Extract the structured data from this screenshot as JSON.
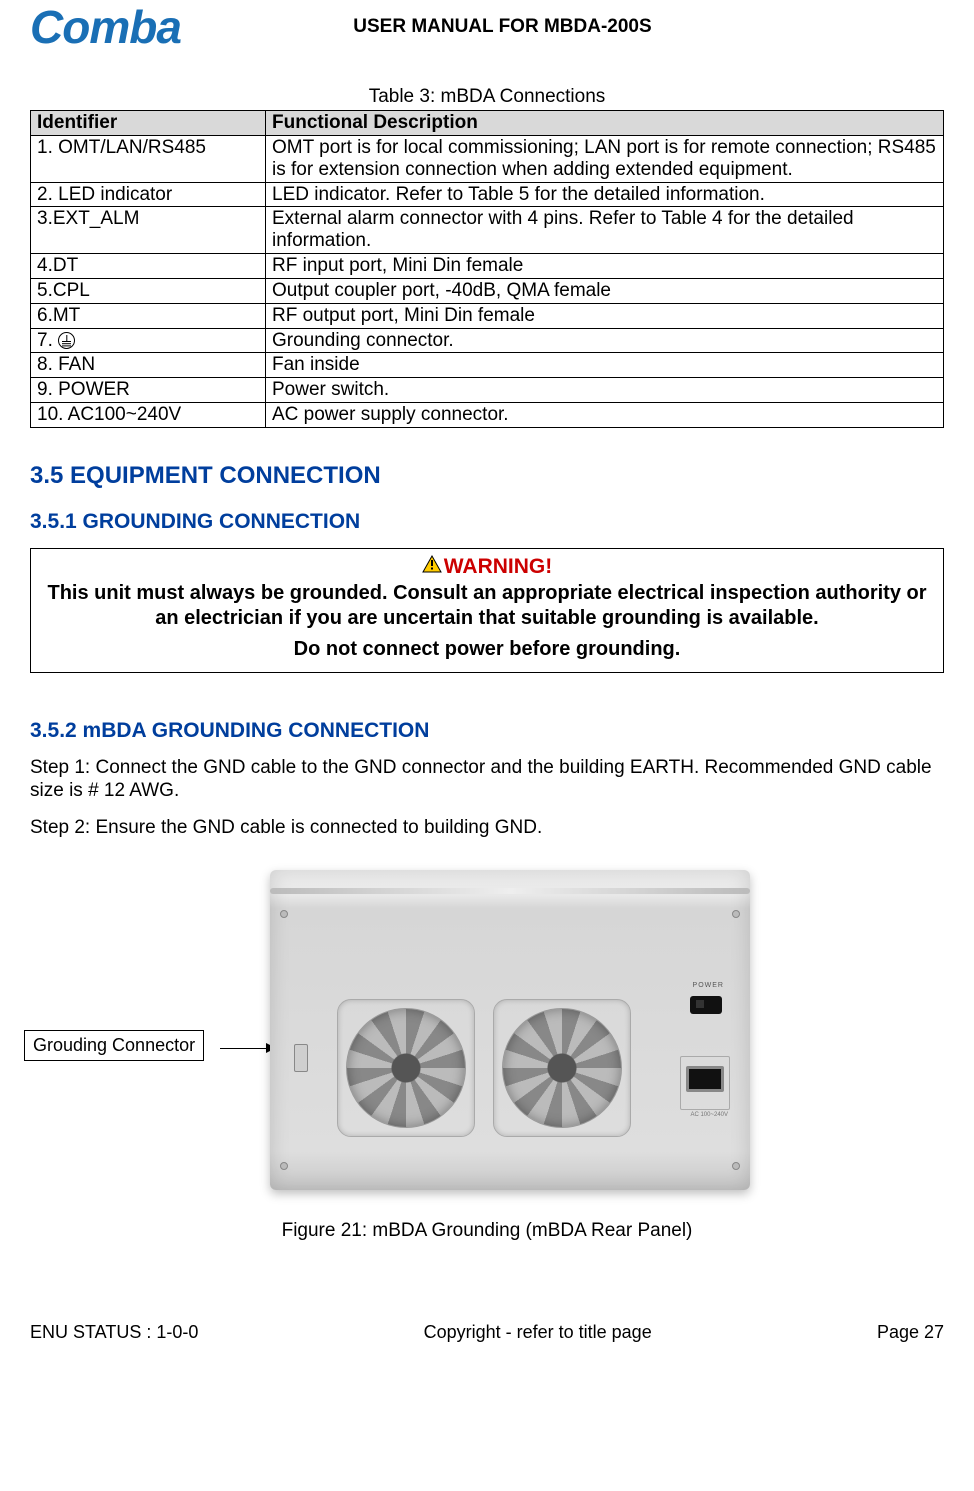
{
  "header": {
    "logo_text": "Comba",
    "title": "USER MANUAL FOR MBDA-200S"
  },
  "table3": {
    "caption": "Table 3: mBDA Connections",
    "headers": [
      "Identifier",
      "Functional Description"
    ],
    "rows": [
      {
        "id": "1. OMT/LAN/RS485",
        "desc": "OMT port is for local commissioning; LAN port is for remote connection; RS485 is for extension connection when adding extended equipment."
      },
      {
        "id": "2. LED indicator",
        "desc": "LED indicator. Refer to Table 5 for the detailed information."
      },
      {
        "id": "3.EXT_ALM",
        "desc": "External alarm connector with 4 pins. Refer to Table 4 for the detailed information."
      },
      {
        "id": "4.DT",
        "desc": "RF input port, Mini Din  female"
      },
      {
        "id": "5.CPL",
        "desc": "Output coupler port, -40dB, QMA female"
      },
      {
        "id": "6.MT",
        "desc": "RF output port, Mini Din  female"
      },
      {
        "id": "7. ",
        "desc": "Grounding connector.",
        "ground_symbol": true
      },
      {
        "id": "8. FAN",
        "desc": "Fan inside"
      },
      {
        "id": "9. POWER",
        "desc": "Power switch."
      },
      {
        "id": "10. AC100~240V",
        "desc": "AC power supply connector."
      }
    ]
  },
  "sections": {
    "s35": "3.5   EQUIPMENT CONNECTION",
    "s351": "3.5.1   GROUNDING CONNECTION",
    "s352": "3.5.2   mBDA GROUNDING CONNECTION"
  },
  "warning": {
    "label": "WARNING!",
    "line1": "This unit must always be grounded. Consult an appropriate electrical inspection authority or an electrician if you are uncertain that suitable grounding is available.",
    "line2": "Do not connect power before grounding."
  },
  "steps": {
    "s1": "Step 1: Connect the GND cable to the GND connector and the building EARTH. Recommended GND cable size is # 12 AWG.",
    "s2": "Step 2: Ensure the GND cable is connected to building GND."
  },
  "figure": {
    "callout": "Grouding Connector",
    "power_label": "POWER",
    "ac_label": "AC 100~240V",
    "caption": "Figure 21: mBDA Grounding (mBDA Rear Panel)"
  },
  "footer": {
    "left": "ENU STATUS : 1-0-0",
    "center": "Copyright - refer to title page",
    "right": "Page 27"
  }
}
